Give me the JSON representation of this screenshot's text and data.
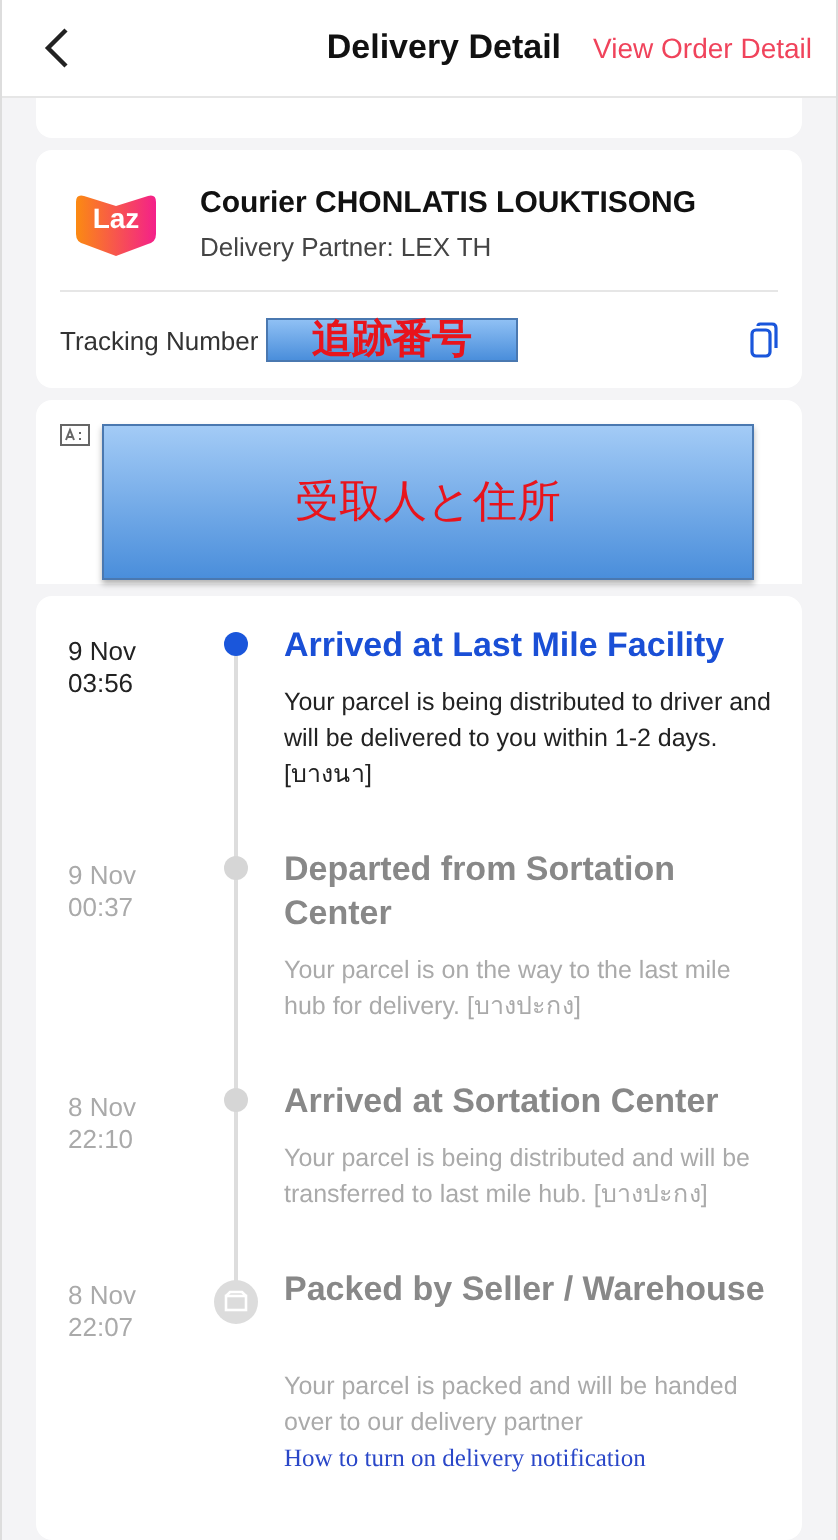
{
  "header": {
    "title": "Delivery Detail",
    "action": "View Order Detail"
  },
  "courier": {
    "logo_text": "Laz",
    "name": "Courier CHONLATIS LOUKTISONG",
    "partner": "Delivery Partner: LEX TH",
    "tracking_label": "Tracking Number",
    "tracking_redaction": "追跡番号"
  },
  "recipient": {
    "redaction": "受取人と住所"
  },
  "events": [
    {
      "kind": "dot",
      "active": true,
      "date": "9 Nov",
      "time": "03:56",
      "title": "Arrived at Last Mile Facility",
      "description": "Your parcel is being distributed to driver and will be delivered to you within 1-2 days. [บางนา]"
    },
    {
      "kind": "dot",
      "active": false,
      "date": "9 Nov",
      "time": "00:37",
      "title": "Departed from Sortation Center",
      "description": "Your parcel is on the way to the last mile hub for delivery. [บางปะกง]"
    },
    {
      "kind": "dot",
      "active": false,
      "date": "8 Nov",
      "time": "22:10",
      "title": "Arrived at Sortation Center",
      "description": "Your parcel is being distributed and will be transferred to last mile hub. [บางปะกง]"
    },
    {
      "kind": "package",
      "active": false,
      "date": "8 Nov",
      "time": "22:07",
      "title": "Packed by Seller / Warehouse",
      "description": "Your parcel is packed and will be handed over to our delivery partner",
      "link": "How to turn on delivery notification"
    }
  ]
}
